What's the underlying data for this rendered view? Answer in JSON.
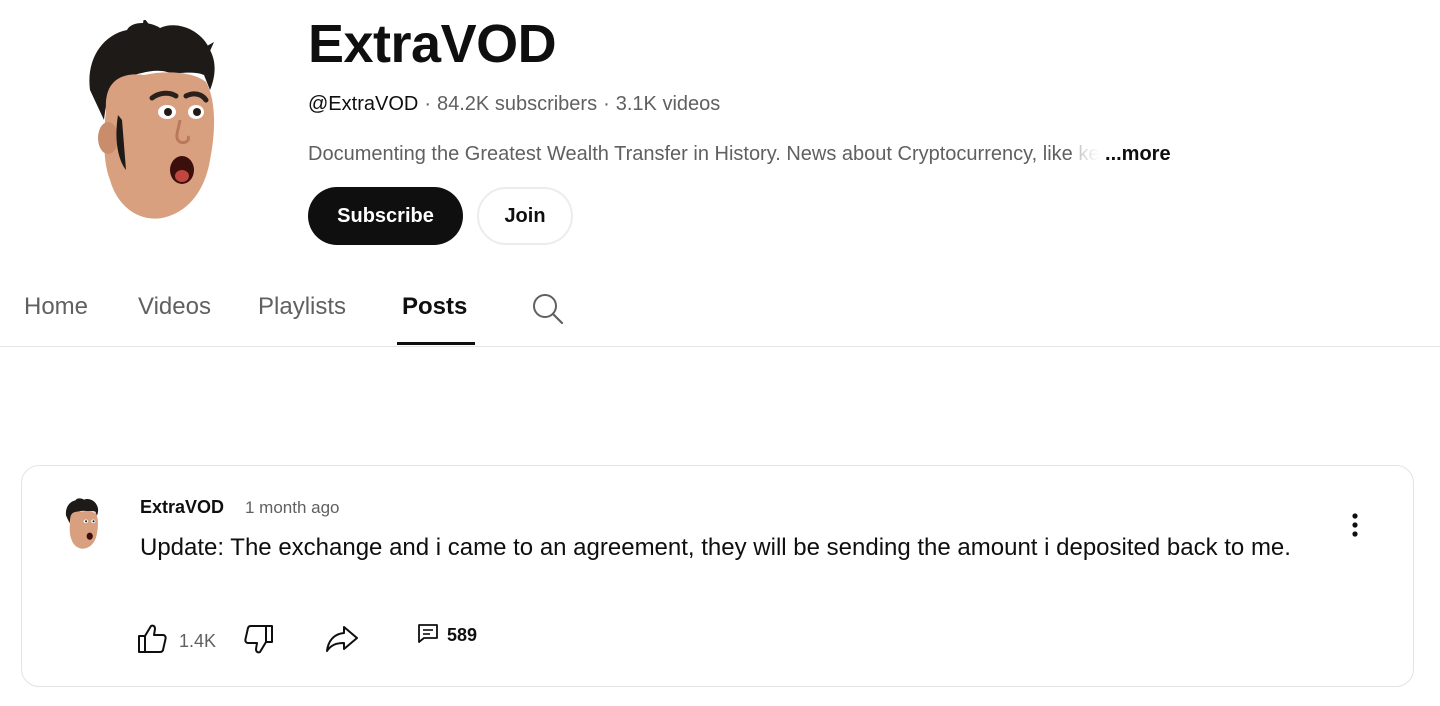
{
  "channel": {
    "name": "ExtraVOD",
    "handle": "@ExtraVOD",
    "subscribers": "84.2K subscribers",
    "videos": "3.1K videos",
    "description": "Documenting the Greatest Wealth Transfer in History. News about Cryptocurrency, like",
    "description_faded": " ke",
    "more_label": "...more",
    "subscribe_label": "Subscribe",
    "join_label": "Join"
  },
  "tabs": [
    {
      "label": "Home",
      "active": false
    },
    {
      "label": "Videos",
      "active": false
    },
    {
      "label": "Playlists",
      "active": false
    },
    {
      "label": "Posts",
      "active": true
    }
  ],
  "post": {
    "author": "ExtraVOD",
    "time": "1 month ago",
    "body": "Update: The exchange and i came to an agreement, they will be sending the amount i deposited back to me.",
    "likes": "1.4K",
    "comments": "589"
  },
  "icons": {
    "search": "search-icon",
    "like": "thumbs-up-icon",
    "dislike": "thumbs-down-icon",
    "share": "share-icon",
    "comment": "comment-icon",
    "more": "more-vertical-icon"
  },
  "colors": {
    "primary_text": "#0f0f0f",
    "secondary_text": "#606060",
    "subscribe_bg": "#0f0f0f",
    "divider": "#e5e5e5"
  }
}
